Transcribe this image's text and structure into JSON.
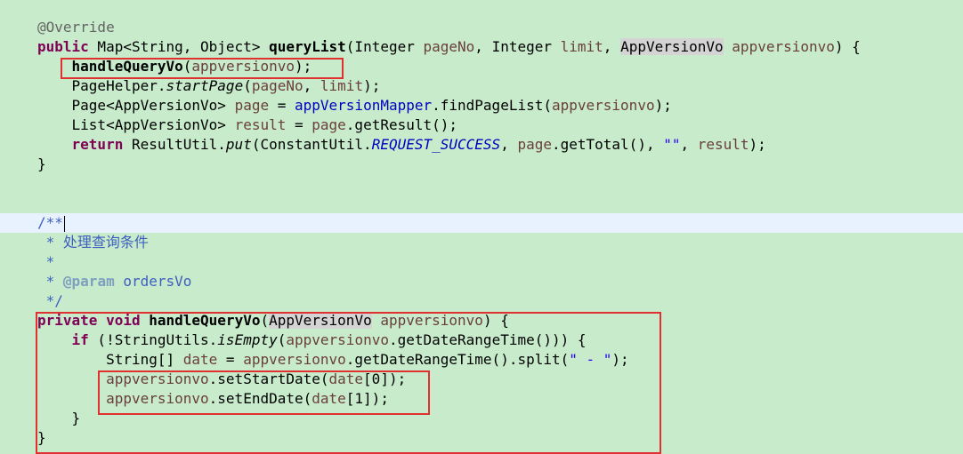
{
  "editor": {
    "lines": [
      "@Override",
      "public Map<String, Object> queryList(Integer pageNo, Integer limit, AppVersionVo appversionvo) {",
      "    handleQueryVo(appversionvo);",
      "    PageHelper.startPage(pageNo, limit);",
      "    Page<AppVersionVo> page = appVersionMapper.findPageList(appversionvo);",
      "    List<AppVersionVo> result = page.getResult();",
      "    return ResultUtil.put(ConstantUtil.REQUEST_SUCCESS, page.getTotal(), \"\", result);",
      "}",
      "",
      "",
      "/**",
      " * 处理查询条件",
      " *",
      " * @param ordersVo",
      " */",
      "private void handleQueryVo(AppVersionVo appversionvo) {",
      "    if (!StringUtils.isEmpty(appversionvo.getDateRangeTime())) {",
      "        String[] date = appversionvo.getDateRangeTime().split(\" - \");",
      "        appversionvo.setStartDate(date[0]);",
      "        appversionvo.setEndDate(date[1]);",
      "    }",
      "}"
    ]
  },
  "colors": {
    "background": "#c7ebcb",
    "current_line": "#e8f2fe",
    "keyword": "#7f0055",
    "field": "#0000c0",
    "parameter": "#6a3e3e",
    "string": "#2a00ff",
    "javadoc": "#3f5fbf",
    "annotation_highlight_box": "#e03030"
  }
}
